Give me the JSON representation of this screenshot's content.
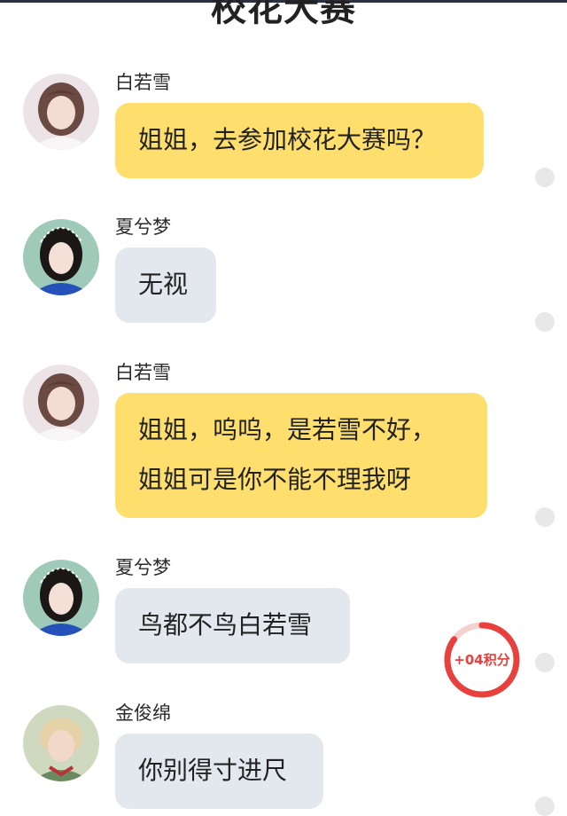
{
  "page": {
    "title": "校花大赛"
  },
  "messages": [
    {
      "sender": "白若雪",
      "lines": [
        "姐姐，去参加校花大赛吗？"
      ],
      "style": "yellow",
      "avatar_icon": "girl-avatar-white-hoodie"
    },
    {
      "sender": "夏兮梦",
      "lines": [
        "无视"
      ],
      "style": "gray",
      "avatar_icon": "girl-avatar-blue-shirt"
    },
    {
      "sender": "白若雪",
      "lines": [
        "姐姐，呜呜，是若雪不好，",
        "姐姐可是你不能不理我呀"
      ],
      "style": "yellow",
      "avatar_icon": "girl-avatar-white-hoodie"
    },
    {
      "sender": "夏兮梦",
      "lines": [
        "鸟都不鸟白若雪"
      ],
      "style": "gray",
      "avatar_icon": "girl-avatar-blue-shirt"
    },
    {
      "sender": "金俊绵",
      "lines": [
        "你别得寸进尺"
      ],
      "style": "gray",
      "avatar_icon": "boy-avatar-blonde"
    }
  ],
  "points_badge": {
    "text": "+04积分",
    "color": "#e8403c",
    "progress": 0.85
  },
  "colors": {
    "yellow_bubble": "#fedf6e",
    "gray_bubble": "#e2e8ee"
  }
}
